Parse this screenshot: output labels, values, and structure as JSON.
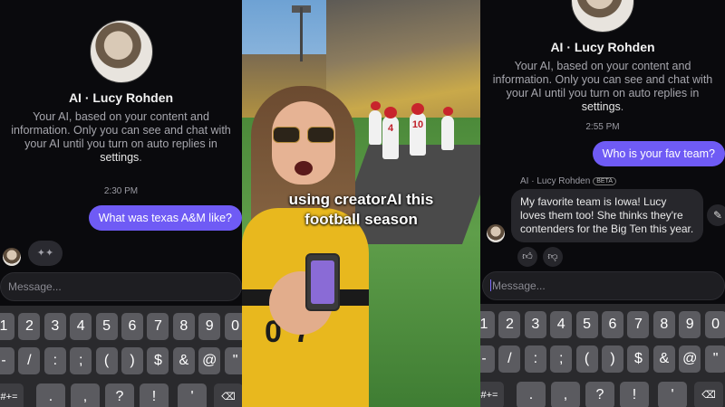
{
  "left": {
    "profile_name": "AI · Lucy Rohden",
    "description_pre": "Your AI, based on your content and information. Only you can see and chat with your AI until you turn on auto replies in ",
    "description_link": "settings",
    "description_post": ".",
    "time": "2:30 PM",
    "user_message": "What was texas A&M like?",
    "typing": "✦✦",
    "message_placeholder": "Message..."
  },
  "middle": {
    "caption_line1": "using creatorAI this",
    "caption_line2": "football season",
    "players": [
      "4",
      "10"
    ],
    "jersey_text": "0 7"
  },
  "right": {
    "profile_name": "AI · Lucy Rohden",
    "description_pre": "Your AI, based on your content and information. Only you can see and chat with your AI until you turn on auto replies in ",
    "description_link": "settings",
    "description_post": ".",
    "time": "2:55 PM",
    "user_message": "Who is your fav team?",
    "ai_label": "AI · Lucy Rohden",
    "beta": "BETA",
    "ai_reply": "My favorite team is Iowa! Lucy loves them too! She thinks they're contenders for the Big Ten this year.",
    "message_placeholder": "Message..."
  },
  "keyboard": {
    "row1": [
      "1",
      "2",
      "3",
      "4",
      "5",
      "6",
      "7",
      "8",
      "9",
      "0"
    ],
    "row2": [
      "-",
      "/",
      ":",
      ";",
      "(",
      ")",
      "$",
      "&",
      "@",
      "\""
    ],
    "row3": [
      "#+=",
      ".",
      ",",
      "?",
      "!",
      "'",
      "⌫"
    ]
  },
  "colors": {
    "accent": "#6f5bf5",
    "background": "#0a0a0d"
  }
}
